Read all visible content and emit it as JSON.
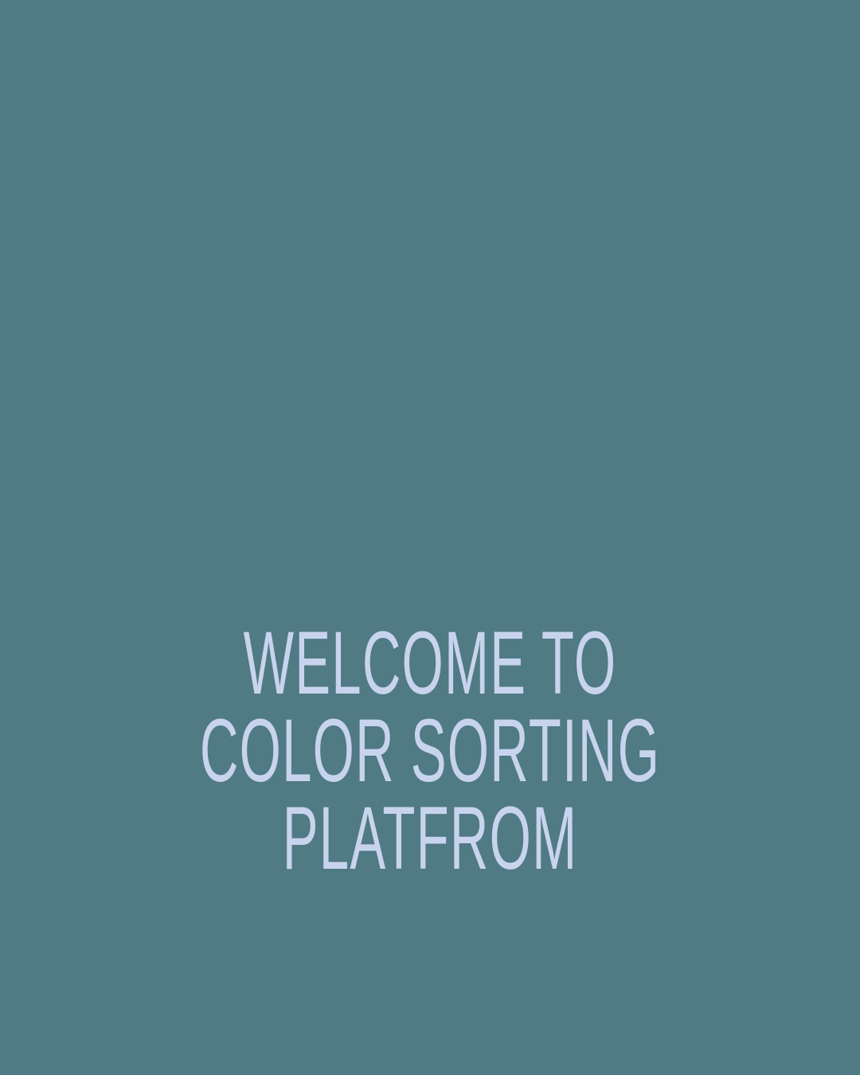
{
  "colors": {
    "background": "#507a84",
    "text": "#c8d4ee"
  },
  "title": {
    "lines": [
      "WELCOME TO",
      "COLOR SORTING",
      "PLATFROM"
    ]
  }
}
